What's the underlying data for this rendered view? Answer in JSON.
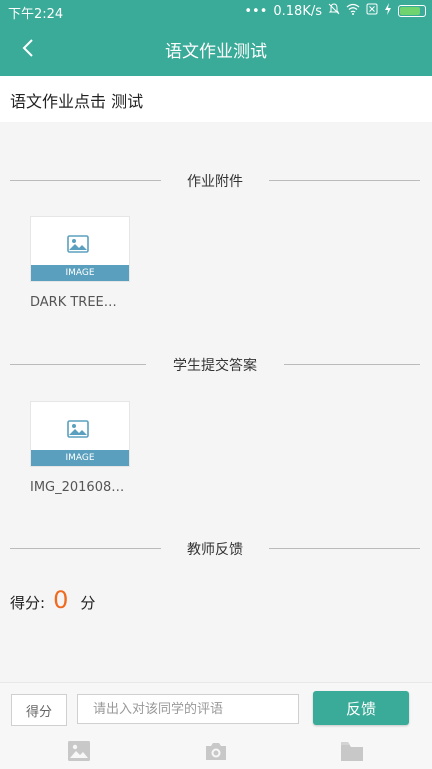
{
  "status_bar": {
    "time": "下午2:24",
    "speed": "0.18K/s",
    "icons": [
      "dots-icon",
      "mute-icon",
      "wifi-icon",
      "sim-icon",
      "bolt-icon",
      "battery-icon"
    ]
  },
  "app_bar": {
    "title": "语文作业测试",
    "back_icon": "back-arrow-icon"
  },
  "homework_title": "语文作业点击 测试",
  "sections": {
    "attachments": {
      "label": "作业附件",
      "files": [
        {
          "thumb_label": "IMAGE",
          "name": "DARK TREE…"
        }
      ]
    },
    "answers": {
      "label": "学生提交答案",
      "files": [
        {
          "thumb_label": "IMAGE",
          "name": "IMG_201608…"
        }
      ]
    },
    "feedback": {
      "label": "教师反馈"
    }
  },
  "score": {
    "label": "得分:",
    "value": "0",
    "unit": "分"
  },
  "bottom_bar": {
    "score_button": "得分",
    "comment_placeholder": "请出入对该同学的评语",
    "feedback_button": "反馈",
    "tools": [
      "image-icon",
      "camera-icon",
      "folder-icon"
    ]
  },
  "colors": {
    "primary": "#3aab98",
    "accent": "#ef6b20",
    "thumb_band": "#5aa0be"
  }
}
